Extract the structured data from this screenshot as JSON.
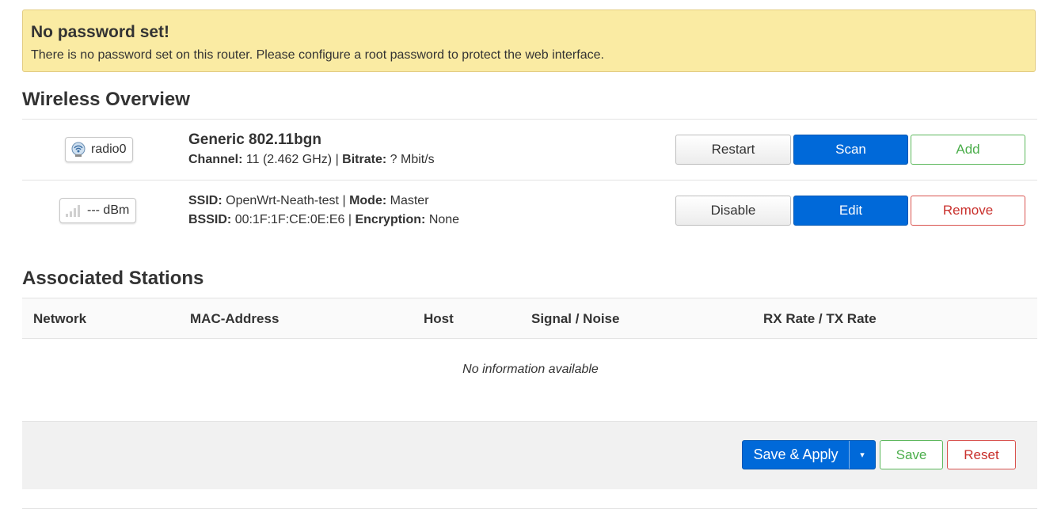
{
  "alert": {
    "title": "No password set!",
    "message": "There is no password set on this router. Please configure a root password to protect the web interface."
  },
  "wireless": {
    "section_title": "Wireless Overview",
    "radio": {
      "badge_label": "radio0",
      "icon": "wifi-radio-icon",
      "name": "Generic 802.11bgn",
      "channel_label": "Channel:",
      "channel_value": "11 (2.462 GHz)",
      "sep": "|",
      "bitrate_label": "Bitrate:",
      "bitrate_value": "? Mbit/s",
      "buttons": {
        "restart": "Restart",
        "scan": "Scan",
        "add": "Add"
      }
    },
    "network": {
      "badge_label": "--- dBm",
      "icon": "signal-bars-icon",
      "ssid_label": "SSID:",
      "ssid_value": "OpenWrt-Neath-test",
      "sep": "|",
      "mode_label": "Mode:",
      "mode_value": "Master",
      "bssid_label": "BSSID:",
      "bssid_value": "00:1F:1F:CE:0E:E6",
      "encryption_label": "Encryption:",
      "encryption_value": "None",
      "buttons": {
        "disable": "Disable",
        "edit": "Edit",
        "remove": "Remove"
      }
    }
  },
  "stations": {
    "section_title": "Associated Stations",
    "columns": [
      "Network",
      "MAC-Address",
      "Host",
      "Signal / Noise",
      "RX Rate / TX Rate"
    ],
    "empty_text": "No information available"
  },
  "footer": {
    "save_apply": "Save & Apply",
    "dropdown_glyph": "▾",
    "save": "Save",
    "reset": "Reset"
  },
  "colors": {
    "primary": "#0069d9",
    "success": "#5cb85c",
    "danger": "#d9534f",
    "alert_bg": "#faeba3"
  }
}
